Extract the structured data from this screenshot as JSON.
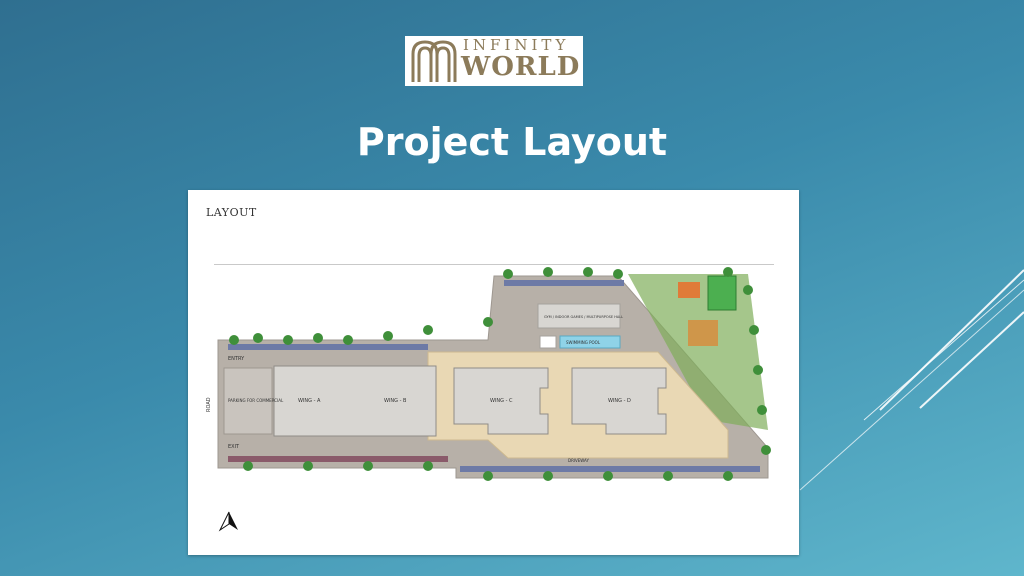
{
  "logo": {
    "line1": "INFINITY",
    "line2": "WORLD",
    "color": "#8c7b5a"
  },
  "slide": {
    "title": "Project Layout"
  },
  "layout_panel": {
    "heading": "LAYOUT",
    "labels": {
      "entry": "ENTRY",
      "exit": "EXIT",
      "road": "ROAD",
      "parking": "PARKING FOR COMMERCIAL",
      "wing_a": "WING - A",
      "wing_b": "WING - B",
      "wing_c": "WING - C",
      "wing_d": "WING - D",
      "clubhouse": "GYM / INDOOR GAMES / MULTIPURPOSE HALL",
      "pool": "SWIMMING POOL",
      "driveway": "DRIVEWAY"
    }
  },
  "colors": {
    "bg_dark": "#2f6f90",
    "bg_light": "#5fb6cc",
    "road": "#b7b0a8",
    "building": "#d8d6d2",
    "paving": "#e9d8b4",
    "tree": "#3f8f3a",
    "pool": "#8fd3e8",
    "court": "#4caf50"
  }
}
